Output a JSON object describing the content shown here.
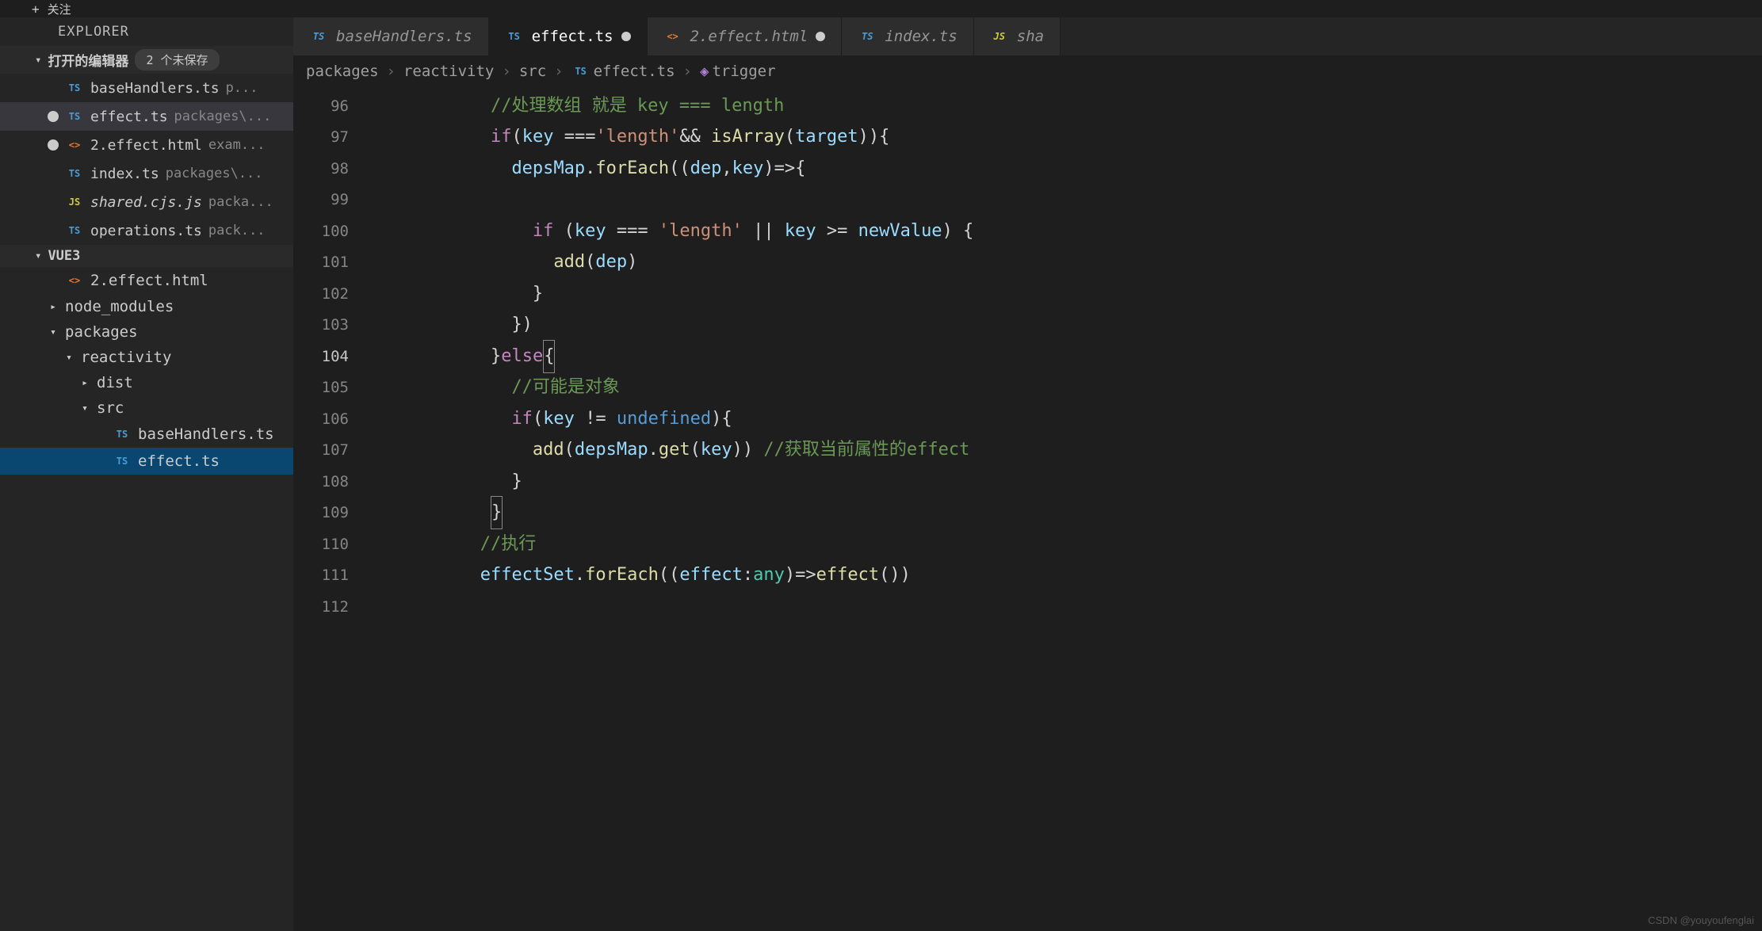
{
  "topbar": {
    "plus": "+",
    "follow": "关注"
  },
  "explorer": {
    "title": "EXPLORER"
  },
  "openEditors": {
    "title": "打开的编辑器",
    "badge": "2 个未保存",
    "items": [
      {
        "icon": "TS",
        "iconClass": "ts-icon",
        "name": "baseHandlers.ts",
        "path": "p...",
        "modified": false
      },
      {
        "icon": "TS",
        "iconClass": "ts-icon",
        "name": "effect.ts",
        "path": "packages\\...",
        "modified": true,
        "active": true
      },
      {
        "icon": "<>",
        "iconClass": "html-icon",
        "name": "2.effect.html",
        "path": "exam...",
        "modified": true
      },
      {
        "icon": "TS",
        "iconClass": "ts-icon",
        "name": "index.ts",
        "path": "packages\\...",
        "modified": false
      },
      {
        "icon": "JS",
        "iconClass": "js-icon",
        "name": "shared.cjs.js",
        "path": "packa...",
        "modified": false,
        "italic": true
      },
      {
        "icon": "TS",
        "iconClass": "ts-icon",
        "name": "operations.ts",
        "path": "pack...",
        "modified": false
      }
    ]
  },
  "project": {
    "name": "VUE3",
    "tree": [
      {
        "indent": 0,
        "chevron": "",
        "icon": "<>",
        "iconClass": "html-icon",
        "name": "2.effect.html"
      },
      {
        "indent": 0,
        "chevron": "▸",
        "icon": "",
        "iconClass": "",
        "name": "node_modules"
      },
      {
        "indent": 0,
        "chevron": "▾",
        "icon": "",
        "iconClass": "",
        "name": "packages"
      },
      {
        "indent": 1,
        "chevron": "▾",
        "icon": "",
        "iconClass": "",
        "name": "reactivity"
      },
      {
        "indent": 2,
        "chevron": "▸",
        "icon": "",
        "iconClass": "",
        "name": "dist"
      },
      {
        "indent": 2,
        "chevron": "▾",
        "icon": "",
        "iconClass": "",
        "name": "src"
      },
      {
        "indent": 3,
        "chevron": "",
        "icon": "TS",
        "iconClass": "ts-icon",
        "name": "baseHandlers.ts"
      },
      {
        "indent": 3,
        "chevron": "",
        "icon": "TS",
        "iconClass": "ts-icon",
        "name": "effect.ts",
        "selected": true
      }
    ]
  },
  "tabs": [
    {
      "icon": "TS",
      "iconClass": "ts-icon",
      "label": "baseHandlers.ts",
      "modified": false,
      "active": false
    },
    {
      "icon": "TS",
      "iconClass": "ts-icon",
      "label": "effect.ts",
      "modified": true,
      "active": true
    },
    {
      "icon": "<>",
      "iconClass": "html-icon",
      "label": "2.effect.html",
      "modified": true,
      "active": false
    },
    {
      "icon": "TS",
      "iconClass": "ts-icon",
      "label": "index.ts",
      "modified": false,
      "active": false
    },
    {
      "icon": "JS",
      "iconClass": "js-icon",
      "label": "sha",
      "modified": false,
      "active": false
    }
  ],
  "breadcrumb": {
    "parts": [
      "packages",
      "reactivity",
      "src",
      "effect.ts",
      "trigger"
    ],
    "fileIcon": "TS",
    "symIcon": "◈"
  },
  "code": {
    "startLine": 96,
    "currentLine": 104,
    "lines": [
      [
        {
          "t": "            ",
          "c": ""
        },
        {
          "t": "//处理数组 就是 key === length",
          "c": "tok-comment"
        }
      ],
      [
        {
          "t": "            ",
          "c": ""
        },
        {
          "t": "if",
          "c": "tok-keyword"
        },
        {
          "t": "(",
          "c": "tok-punct"
        },
        {
          "t": "key",
          "c": "tok-var"
        },
        {
          "t": " ===",
          "c": "tok-op"
        },
        {
          "t": "'length'",
          "c": "tok-string"
        },
        {
          "t": "&& ",
          "c": "tok-op"
        },
        {
          "t": "isArray",
          "c": "tok-func"
        },
        {
          "t": "(",
          "c": "tok-punct"
        },
        {
          "t": "target",
          "c": "tok-var"
        },
        {
          "t": ")){",
          "c": "tok-punct"
        }
      ],
      [
        {
          "t": "              ",
          "c": ""
        },
        {
          "t": "depsMap",
          "c": "tok-var"
        },
        {
          "t": ".",
          "c": "tok-punct"
        },
        {
          "t": "forEach",
          "c": "tok-func"
        },
        {
          "t": "((",
          "c": "tok-punct"
        },
        {
          "t": "dep",
          "c": "tok-param"
        },
        {
          "t": ",",
          "c": "tok-punct"
        },
        {
          "t": "key",
          "c": "tok-param"
        },
        {
          "t": ")=>{",
          "c": "tok-punct"
        }
      ],
      [
        {
          "t": "",
          "c": ""
        }
      ],
      [
        {
          "t": "                ",
          "c": ""
        },
        {
          "t": "if",
          "c": "tok-keyword"
        },
        {
          "t": " (",
          "c": "tok-punct"
        },
        {
          "t": "key",
          "c": "tok-var"
        },
        {
          "t": " === ",
          "c": "tok-op"
        },
        {
          "t": "'length'",
          "c": "tok-string"
        },
        {
          "t": " || ",
          "c": "tok-op"
        },
        {
          "t": "key",
          "c": "tok-var"
        },
        {
          "t": " >= ",
          "c": "tok-op"
        },
        {
          "t": "newValue",
          "c": "tok-var"
        },
        {
          "t": ") {",
          "c": "tok-punct"
        }
      ],
      [
        {
          "t": "                  ",
          "c": ""
        },
        {
          "t": "add",
          "c": "tok-func"
        },
        {
          "t": "(",
          "c": "tok-punct"
        },
        {
          "t": "dep",
          "c": "tok-var"
        },
        {
          "t": ")",
          "c": "tok-punct"
        }
      ],
      [
        {
          "t": "                ",
          "c": ""
        },
        {
          "t": "}",
          "c": "tok-punct"
        }
      ],
      [
        {
          "t": "              ",
          "c": ""
        },
        {
          "t": "})",
          "c": "tok-punct"
        }
      ],
      [
        {
          "t": "            ",
          "c": ""
        },
        {
          "t": "}",
          "c": "tok-punct"
        },
        {
          "t": "else",
          "c": "tok-keyword"
        },
        {
          "t": "{",
          "c": "tok-punct cursor-box"
        }
      ],
      [
        {
          "t": "              ",
          "c": ""
        },
        {
          "t": "//可能是对象",
          "c": "tok-comment"
        }
      ],
      [
        {
          "t": "              ",
          "c": ""
        },
        {
          "t": "if",
          "c": "tok-keyword"
        },
        {
          "t": "(",
          "c": "tok-punct"
        },
        {
          "t": "key",
          "c": "tok-var"
        },
        {
          "t": " != ",
          "c": "tok-op"
        },
        {
          "t": "undefined",
          "c": "tok-const"
        },
        {
          "t": "){",
          "c": "tok-punct"
        }
      ],
      [
        {
          "t": "                ",
          "c": ""
        },
        {
          "t": "add",
          "c": "tok-func"
        },
        {
          "t": "(",
          "c": "tok-punct"
        },
        {
          "t": "depsMap",
          "c": "tok-var"
        },
        {
          "t": ".",
          "c": "tok-punct"
        },
        {
          "t": "get",
          "c": "tok-func"
        },
        {
          "t": "(",
          "c": "tok-punct"
        },
        {
          "t": "key",
          "c": "tok-var"
        },
        {
          "t": ")) ",
          "c": "tok-punct"
        },
        {
          "t": "//获取当前属性的effect",
          "c": "tok-comment"
        }
      ],
      [
        {
          "t": "              ",
          "c": ""
        },
        {
          "t": "}",
          "c": "tok-punct"
        }
      ],
      [
        {
          "t": "            ",
          "c": ""
        },
        {
          "t": "}",
          "c": "tok-punct cursor-box"
        }
      ],
      [
        {
          "t": "           ",
          "c": ""
        },
        {
          "t": "//执行",
          "c": "tok-comment"
        }
      ],
      [
        {
          "t": "           ",
          "c": ""
        },
        {
          "t": "effectSet",
          "c": "tok-var"
        },
        {
          "t": ".",
          "c": "tok-punct"
        },
        {
          "t": "forEach",
          "c": "tok-func"
        },
        {
          "t": "((",
          "c": "tok-punct"
        },
        {
          "t": "effect",
          "c": "tok-param"
        },
        {
          "t": ":",
          "c": "tok-punct"
        },
        {
          "t": "any",
          "c": "tok-type"
        },
        {
          "t": ")=>",
          "c": "tok-punct"
        },
        {
          "t": "effect",
          "c": "tok-func"
        },
        {
          "t": "())",
          "c": "tok-punct"
        }
      ],
      [
        {
          "t": "",
          "c": ""
        }
      ]
    ]
  },
  "watermark": "CSDN @youyoufenglai"
}
